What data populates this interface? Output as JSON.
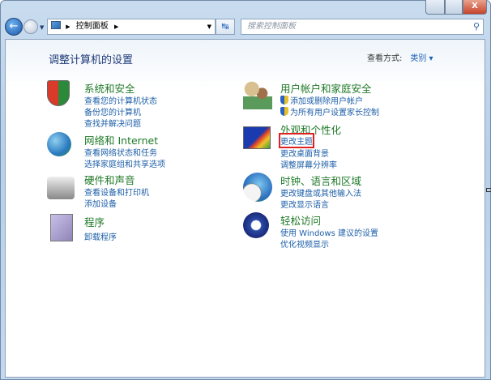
{
  "window": {
    "close_label": "X"
  },
  "nav": {
    "back_icon": "←",
    "address_root": "控制面板",
    "search_placeholder": "搜索控制面板"
  },
  "main": {
    "title": "调整计算机的设置",
    "view_by_label": "查看方式:",
    "view_by_value": "类别"
  },
  "categories": {
    "system": {
      "title": "系统和安全",
      "links": [
        "查看您的计算机状态",
        "备份您的计算机",
        "查找并解决问题"
      ]
    },
    "network": {
      "title": "网络和 Internet",
      "links": [
        "查看网络状态和任务",
        "选择家庭组和共享选项"
      ]
    },
    "hardware": {
      "title": "硬件和声音",
      "links": [
        "查看设备和打印机",
        "添加设备"
      ]
    },
    "programs": {
      "title": "程序",
      "links": [
        "卸载程序"
      ]
    },
    "users": {
      "title": "用户帐户和家庭安全",
      "links": [
        "添加或删除用户帐户",
        "为所有用户设置家长控制"
      ]
    },
    "appearance": {
      "title": "外观和个性化",
      "links": [
        "更改主题",
        "更改桌面背景",
        "调整屏幕分辨率"
      ]
    },
    "clock": {
      "title": "时钟、语言和区域",
      "links": [
        "更改键盘或其他输入法",
        "更改显示语言"
      ]
    },
    "access": {
      "title": "轻松访问",
      "links": [
        "使用 Windows 建议的设置",
        "优化视频显示"
      ]
    }
  },
  "colors": {
    "heading": "#1f7a28",
    "link": "#1e5fa8",
    "highlight": "#e0211f"
  }
}
